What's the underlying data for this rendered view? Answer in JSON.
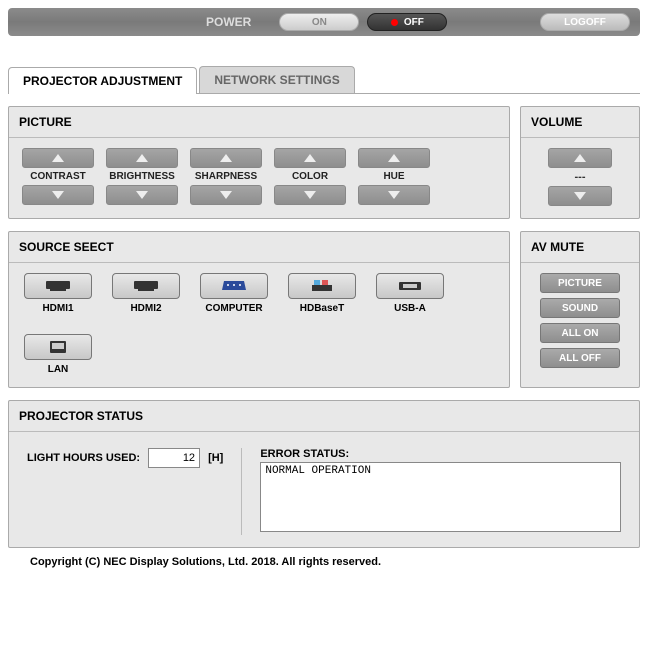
{
  "header": {
    "power_label": "POWER",
    "on_label": "ON",
    "off_label": "OFF",
    "logoff_label": "LOGOFF"
  },
  "tabs": {
    "adj": "PROJECTOR ADJUSTMENT",
    "net": "NETWORK SETTINGS"
  },
  "picture": {
    "title": "PICTURE",
    "items": [
      "CONTRAST",
      "BRIGHTNESS",
      "SHARPNESS",
      "COLOR",
      "HUE"
    ]
  },
  "volume": {
    "title": "VOLUME",
    "value": "---"
  },
  "source": {
    "title": "SOURCE SEECT",
    "items": [
      "HDMI1",
      "HDMI2",
      "COMPUTER",
      "HDBaseT",
      "USB-A",
      "LAN"
    ]
  },
  "avmute": {
    "title": "AV MUTE",
    "picture": "PICTURE",
    "sound": "SOUND",
    "allon": "ALL ON",
    "alloff": "ALL OFF"
  },
  "status": {
    "title": "PROJECTOR STATUS",
    "hours_label": "LIGHT HOURS USED:",
    "hours_value": "12",
    "hours_unit": "[H]",
    "error_label": "ERROR STATUS:",
    "error_text": "NORMAL OPERATION"
  },
  "copyright": "Copyright (C) NEC Display Solutions, Ltd. 2018. All rights reserved."
}
